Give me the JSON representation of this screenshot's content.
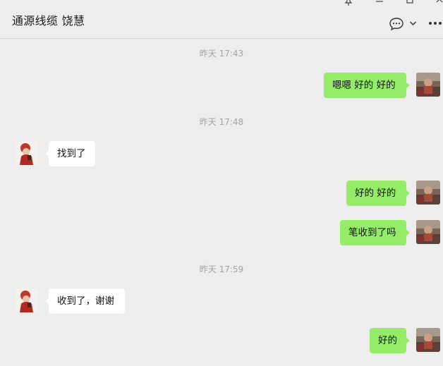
{
  "header": {
    "title": "通源线缆 饶慧",
    "icons": [
      "pin-icon",
      "minimize-icon",
      "maximize-icon",
      "close-icon",
      "chat-bubble-icon",
      "chevron-down-icon",
      "more-icon"
    ]
  },
  "messages": [
    {
      "type": "time",
      "text": "昨天 17:43"
    },
    {
      "type": "out",
      "text": "嗯嗯 好的 好的"
    },
    {
      "type": "time",
      "text": "昨天 17:48"
    },
    {
      "type": "in",
      "text": "找到了"
    },
    {
      "type": "out",
      "text": "好的 好的"
    },
    {
      "type": "out",
      "text": "笔收到了吗"
    },
    {
      "type": "time",
      "text": "昨天 17:59"
    },
    {
      "type": "in",
      "text": "收到了，谢谢"
    },
    {
      "type": "out",
      "text": "好的"
    }
  ],
  "colors": {
    "background": "#ededed",
    "outgoing_bubble": "#95ec69",
    "incoming_bubble": "#ffffff",
    "timestamp": "#a3a3a3"
  }
}
